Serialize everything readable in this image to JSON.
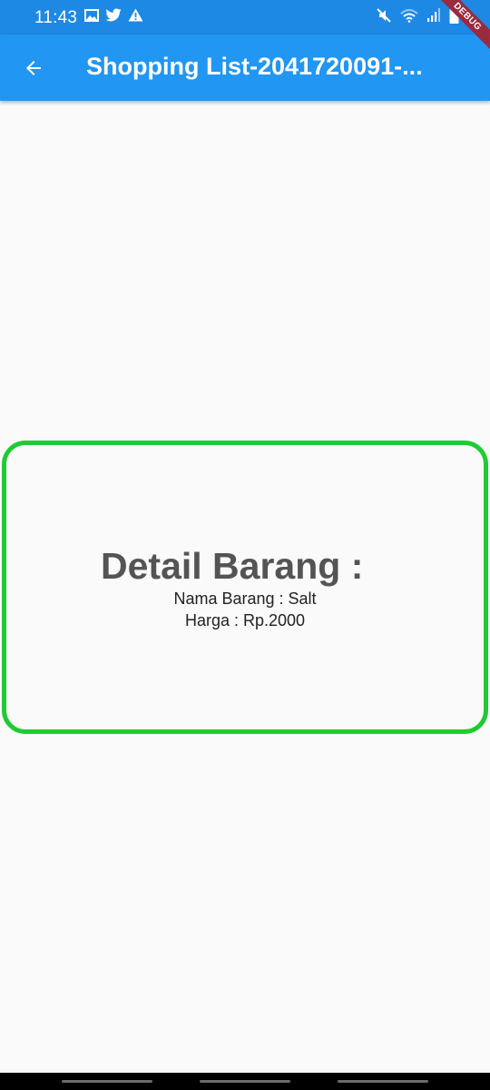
{
  "status_bar": {
    "time": "11:43",
    "left_icons": [
      "image-icon",
      "twitter-icon",
      "warning-icon"
    ],
    "right_icons": [
      "mute-icon",
      "wifi-icon",
      "signal-icon",
      "battery-icon"
    ]
  },
  "app_bar": {
    "title": "Shopping List-2041720091-...",
    "back_icon": "arrow-back-icon",
    "color": "#2196f3"
  },
  "debug_banner": {
    "label": "DEBUG"
  },
  "detail": {
    "title": "Detail Barang :",
    "name_line": "Nama Barang : Salt",
    "price_line": "Harga : Rp.2000",
    "border_color": "#1ecb33"
  }
}
